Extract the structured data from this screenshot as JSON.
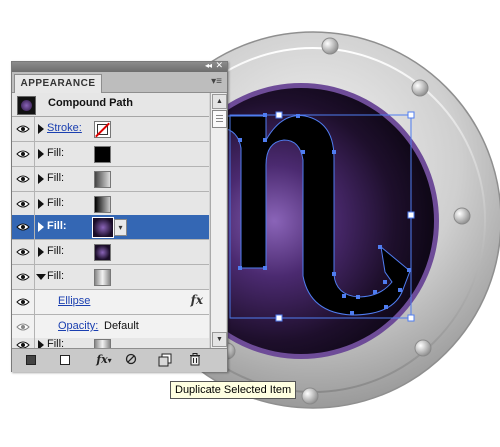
{
  "panel": {
    "tab_label": "APPEARANCE",
    "collapse_glyph": "◂◂",
    "close_glyph": "✕",
    "menu_glyph": "▾≡",
    "header_title": "Compound Path",
    "rows": [
      {
        "label": "Stroke:",
        "swatch": "none"
      },
      {
        "label": "Fill:",
        "swatch": "black"
      },
      {
        "label": "Fill:",
        "swatch": "linear-gradient"
      },
      {
        "label": "Fill:",
        "swatch": "linear-gradient-dark"
      },
      {
        "label": "Fill:",
        "swatch": "radial-gradient",
        "selected": true
      },
      {
        "label": "Fill:",
        "swatch": "radial-gradient"
      },
      {
        "label": "Fill:",
        "swatch": "gray-gradient",
        "expanded": true
      },
      {
        "label": "Fill:",
        "swatch": "gray-gradient"
      }
    ],
    "effect_label": "Ellipse",
    "opacity_label": "Opacity:",
    "opacity_value": "Default",
    "fx_glyph": "fx",
    "dropdown_glyph": "▾",
    "scroll_up_glyph": "▲",
    "scroll_down_glyph": "▼",
    "bottom_bar": {
      "new_art_basic_icon": "new-art-basic-appearance-icon",
      "clear_icon": "clear-appearance-icon",
      "fx_glyph": "fx",
      "fx_arrow": "▾",
      "reduce_icon": "reduce-to-basic-appearance-icon",
      "duplicate_icon": "duplicate-item-icon",
      "delete_icon": "trash-icon"
    }
  },
  "tooltip": "Duplicate Selected Item",
  "colors": {
    "selection_blue": "#3467b4",
    "bezel_purple": "#7a55a8",
    "path_outline": "#4f7df0"
  }
}
